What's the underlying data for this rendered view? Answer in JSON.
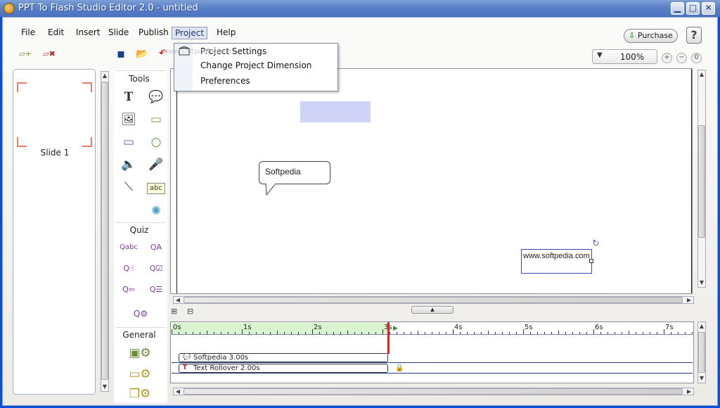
{
  "window": {
    "title": "PPT To Flash Studio Editor 2.0 - untitled",
    "minimize_glyph": "▁",
    "maximize_glyph": "□",
    "close_glyph": "✕"
  },
  "menu": {
    "items": [
      "File",
      "Edit",
      "Insert",
      "Slide",
      "Publish",
      "Project",
      "Help"
    ],
    "active": "Project"
  },
  "purchase": {
    "label": "Purchase",
    "icon_glyph": "⇩"
  },
  "help_button": {
    "label": "?"
  },
  "project_menu": {
    "items": [
      "Project Settings",
      "Change Project Dimension",
      "Preferences"
    ]
  },
  "watermark": "www.softpedia.com",
  "toolbar_icons": {
    "add_slide": "▱+",
    "delete_slide": "▱✖",
    "save": "▪",
    "open": "📂",
    "undo": "↶"
  },
  "zoom": {
    "value": "100%",
    "arrow": "▼",
    "plus": "+",
    "minus": "−",
    "reset": "0"
  },
  "slides": [
    {
      "label": "Slide 1"
    }
  ],
  "tools_panel": {
    "tools_title": "Tools",
    "quiz_title": "Quiz",
    "general_title": "General",
    "glyphs": {
      "text": "T",
      "callout": "💬",
      "image": "🖼",
      "rectangle": "▭",
      "shape_rect": "▭",
      "circle": "○",
      "sound": "🔈",
      "microphone": "🎤",
      "line": "⟍",
      "text_input": "abc",
      "flash": "✺",
      "quiz_fill": "Qabc",
      "quiz_text": "QA",
      "quiz_click": "Q☝",
      "quiz_multi": "Q☑",
      "quiz_drag": "Q⇦",
      "quiz_list": "Q☰",
      "quiz_settings": "Q⚙",
      "gen_image": "▣⚙",
      "gen_note": "▭⚙",
      "gen_pages": "❐⚙"
    }
  },
  "canvas": {
    "callout_text": "Softpedia",
    "textbox_text": "www.softpedia.com",
    "rotate_glyph": "↻"
  },
  "timeline": {
    "tick_labels": [
      "0s",
      "1s",
      "2s",
      "3s",
      "4s",
      "5s",
      "6s",
      "7s"
    ],
    "tracks": [
      {
        "label": "Softpedia  3.00s",
        "icon": "💬"
      },
      {
        "label": "Text Rollover  2.00s",
        "icon": "T"
      }
    ],
    "lock_glyph": "🔒",
    "collapse_glyph": "▲",
    "play_glyph": "▶",
    "layout_icons": [
      "⊞",
      "⊟"
    ]
  },
  "colors": {
    "title_bar": "#5a80c8",
    "ruler_active": "#d9f5cf",
    "playhead": "#dd2222",
    "shape_fill": "#cfd3f7",
    "slide_frame": "#f07a6a"
  }
}
